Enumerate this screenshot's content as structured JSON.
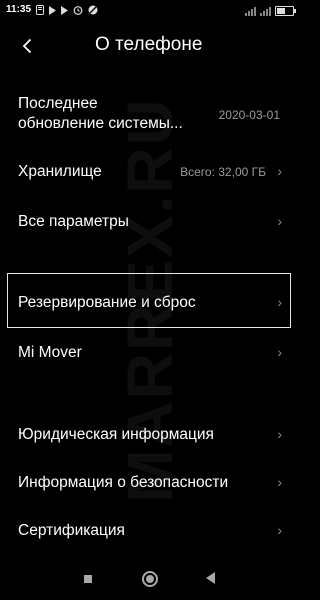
{
  "status_bar": {
    "time": "11:35",
    "battery_level": 0.5
  },
  "header": {
    "title": "О телефоне"
  },
  "settings": {
    "last_update": {
      "label_line1": "Последнее",
      "label_line2": "обновление системы...",
      "value": "2020-03-01"
    },
    "storage": {
      "label": "Хранилище",
      "value": "Всего: 32,00 ГБ"
    },
    "all_params": {
      "label": "Все параметры"
    },
    "backup": {
      "label": "Резервирование и сброс"
    },
    "mi_mover": {
      "label": "Mi Mover"
    },
    "legal": {
      "label": "Юридическая информация"
    },
    "security_info": {
      "label": "Информация о безопасности"
    },
    "certification": {
      "label": "Сертификация"
    }
  },
  "watermark": "MARREX.RU",
  "chevron_glyph": "›",
  "back_glyph": "‹",
  "colors": {
    "background": "#000000",
    "text": "#ffffff",
    "secondary_text": "#9a9a9a"
  }
}
